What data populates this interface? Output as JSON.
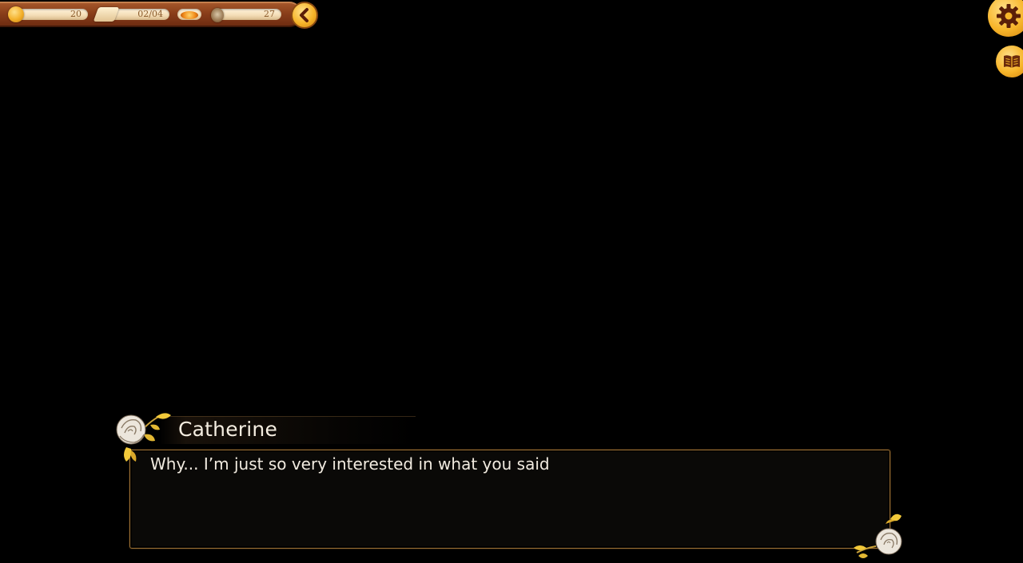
{
  "hud": {
    "coins": "20",
    "scene_progress": "02/04",
    "time": "27"
  },
  "dialogue": {
    "speaker": "Catherine",
    "line": "Why... I’m just so very interested in what you said"
  },
  "icons": {
    "hud_coin": "coin-icon",
    "hud_scene": "scroll-icon",
    "hud_mid": "gem-icon",
    "hud_time": "clock-icon",
    "back": "chevron-left-icon",
    "settings": "gear-icon",
    "journal": "book-icon",
    "ornament": "rose-icon"
  },
  "colors": {
    "background": "#000000",
    "hud_wood": "#8a3e1a",
    "accent_gold": "#f7b52a",
    "box_border": "#9a7034",
    "text": "#f1ebe0"
  }
}
